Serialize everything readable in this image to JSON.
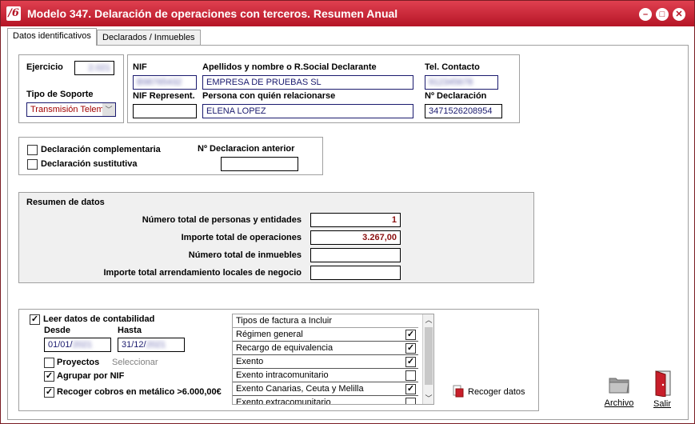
{
  "window": {
    "title": "Modelo 347. Delaración de operaciones con terceros. Resumen Anual",
    "logo_text": "/6",
    "btn_min": "–",
    "btn_max": "□",
    "btn_close": "✕"
  },
  "tabs": [
    {
      "label": "Datos identificativos",
      "active": true
    },
    {
      "label": "Declarados / Inmuebles",
      "active": false
    }
  ],
  "ejercicio": {
    "label": "Ejercicio",
    "value": "2.021"
  },
  "soporte": {
    "label": "Tipo de Soporte",
    "value": "Transmisión Telem"
  },
  "nif": {
    "label": "NIF",
    "value": "B98765432"
  },
  "razon": {
    "label": "Apellidos y nombre o R.Social Declarante",
    "value": "EMPRESA DE PRUEBAS SL"
  },
  "tel": {
    "label": "Tel. Contacto",
    "value": "912345678"
  },
  "nif_rep": {
    "label": "NIF Represent.",
    "value": ""
  },
  "persona": {
    "label": "Persona con quién relacionarse",
    "value": "ELENA LOPEZ"
  },
  "num_decl": {
    "label": "Nº Declaración",
    "value": "3471526208954"
  },
  "complementaria": {
    "label": "Declaración complementaria",
    "checked": false
  },
  "sustitutiva": {
    "label": "Declaración sustitutiva",
    "checked": false
  },
  "decl_anterior": {
    "label": "Nº Declaracion anterior",
    "value": ""
  },
  "resumen": {
    "title": "Resumen de datos",
    "rows": [
      {
        "label": "Número total de personas y entidades",
        "value": "1"
      },
      {
        "label": "Importe total de operaciones",
        "value": "3.267,00"
      },
      {
        "label": "Número total de inmuebles",
        "value": ""
      },
      {
        "label": "Importe total arrendamiento locales de negocio",
        "value": ""
      }
    ]
  },
  "contab": {
    "leer_label": "Leer datos de contabilidad",
    "leer_checked": true,
    "desde_label": "Desde",
    "desde_value": "01/01/",
    "desde_hidden": "2021",
    "hasta_label": "Hasta",
    "hasta_value": "31/12/",
    "hasta_hidden": "2021",
    "proyectos_label": "Proyectos",
    "proyectos_checked": false,
    "seleccionar": "Seleccionar",
    "agrupar_label": "Agrupar por NIF",
    "agrupar_checked": true,
    "cobros_label": "Recoger cobros en metálico >6.000,00€",
    "cobros_checked": true
  },
  "tipos": {
    "header": "Tipos de factura a Incluir",
    "items": [
      {
        "label": "Régimen general",
        "checked": true
      },
      {
        "label": "Recargo de equivalencia",
        "checked": true
      },
      {
        "label": "Exento",
        "checked": true
      },
      {
        "label": "Exento intracomunitario",
        "checked": false
      },
      {
        "label": "Exento Canarias, Ceuta y Melilla",
        "checked": true
      },
      {
        "label": "Exento extracomunitario",
        "checked": false
      }
    ]
  },
  "actions": {
    "recoger": "Recoger datos",
    "archivo": "Archivo",
    "salir": "Salir"
  }
}
